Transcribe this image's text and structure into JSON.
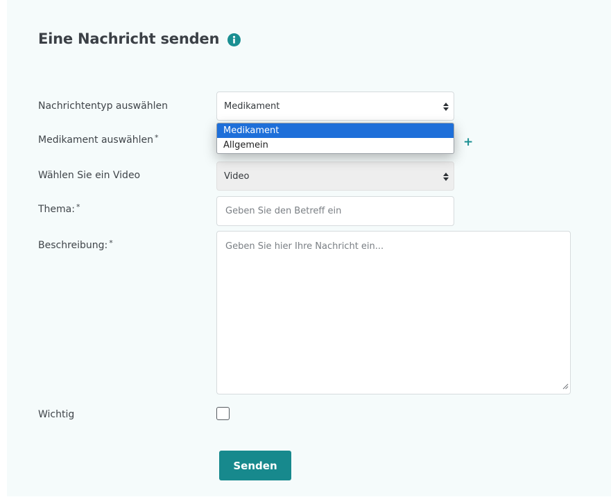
{
  "header": {
    "title": "Eine Nachricht senden",
    "info_icon": "info-circle-icon"
  },
  "form": {
    "message_type": {
      "label": "Nachrichtentyp auswählen",
      "value": "Medikament",
      "options": [
        "Medikament",
        "Allgemein"
      ],
      "highlighted_option": "Medikament"
    },
    "medication": {
      "label": "Medikament auswählen",
      "required_mark": "*",
      "add_label": "+"
    },
    "video": {
      "label": "Wählen Sie ein Video",
      "value": "Video"
    },
    "subject": {
      "label": "Thema:",
      "required_mark": "*",
      "placeholder": "Geben Sie den Betreff ein"
    },
    "description": {
      "label": "Beschreibung:",
      "required_mark": "*",
      "placeholder": "Geben Sie hier Ihre Nachricht ein..."
    },
    "important": {
      "label": "Wichtig",
      "checked": false
    },
    "submit_label": "Senden"
  },
  "colors": {
    "accent": "#17898d",
    "panel_background": "#f5fbfb",
    "dropdown_highlight": "#1e6fd9"
  }
}
